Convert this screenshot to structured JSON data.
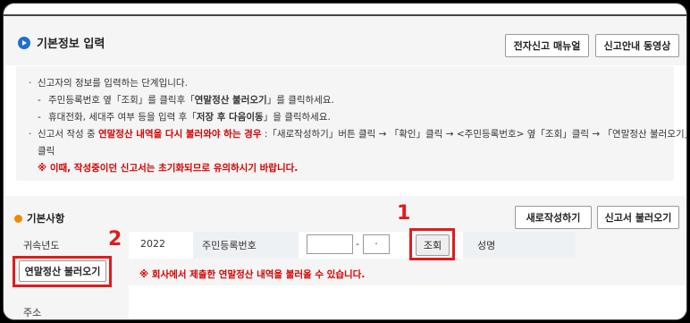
{
  "header": {
    "title": "기본정보 입력",
    "btn_manual": "전자신고 매뉴얼",
    "btn_video": "신고안내 동영상"
  },
  "notice": {
    "line1": "신고자의 정보를 입력하는 단계입니다.",
    "line2_pre": "주민등록번호 옆「조회」를 클릭후「",
    "line2_bold": "연말정산 불러오기",
    "line2_post": "」를 클릭하세요.",
    "line3_pre": "휴대전화, 세대주 여부 등을 입력 후「",
    "line3_bold": "저장 후 다음이동",
    "line3_post": "」을 클릭하세요.",
    "line4_pre": "신고서 작성 중 ",
    "line4_red": "연말정산 내역을 다시 불러와야 하는 경우",
    "line4_post": " :「새로작성하기」버튼 클릭 → 「확인」클릭 → <주민등록번호> 옆「조회」클릭 → 「연말정산 불러오기」",
    "line5": "클릭",
    "line6": "※ 이때, 작성중이던 신고서는 초기화되므로 유의하시기 바랍니다."
  },
  "basic": {
    "title": "기본사항",
    "btn_new": "새로작성하기",
    "btn_load": "신고서 불러오기",
    "label_year": "귀속년도",
    "year_value": "2022",
    "label_rrn": "주민등록번호",
    "rrn_sep": "-",
    "rrn_back_value": "·",
    "btn_search": "조회",
    "label_name": "성명",
    "btn_year_end": "연말정산 불러오기",
    "warn": "※ 회사에서 제출한 연말정산 내역을 불러올 수 있습니다.",
    "label_address": "주소"
  },
  "annotations": {
    "num1": "1",
    "num2": "2"
  },
  "colors": {
    "accent_blue": "#1f6fd0",
    "accent_orange": "#f08a00",
    "highlight_red": "#e01b1b",
    "warn_red": "#d40000"
  }
}
